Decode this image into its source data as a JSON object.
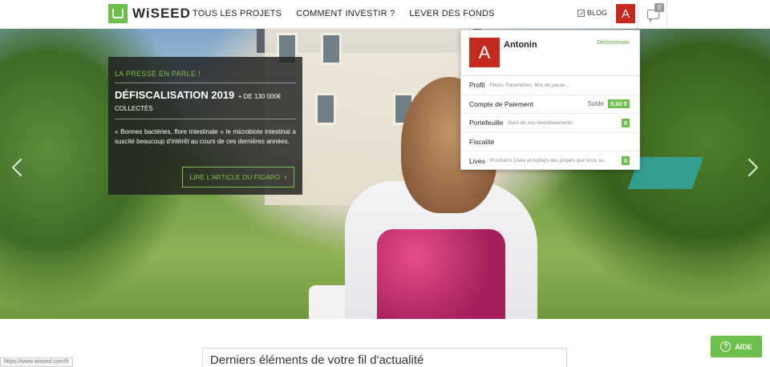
{
  "header": {
    "brand": "WiSEED",
    "nav": [
      "TOUS LES PROJETS",
      "COMMENT INVESTIR ?",
      "LEVER DES FONDS"
    ],
    "blog": "BLOG",
    "avatar_letter": "A",
    "messages_count": "0"
  },
  "press": {
    "label": "LA PRESSE EN PARLE !",
    "title_big": "DÉFISCALISATION 2019",
    "title_small": "+ DE 130 000€",
    "title_line2": "COLLECTÉS",
    "text": "« Bonnes bactéries, flore intestinale » le microbiote intestinal a suscité beaucoup d'intérêt au cours de ces dernières années.",
    "button": "LIRE L'ARTICLE DU FIGARO"
  },
  "dropdown": {
    "avatar_letter": "A",
    "name": "Antonin",
    "logout": "Déconnexion",
    "rows": [
      {
        "title": "Profil",
        "sub": "Photo, Paramètres, Mot de passe..."
      },
      {
        "title": "Compte de Paiement",
        "solde_label": "Solde",
        "badge": "0,00 €"
      },
      {
        "title": "Portefeuille",
        "sub": "Suivi de vos investissements",
        "badge": "0"
      },
      {
        "title": "Fiscalité"
      },
      {
        "title": "Lives",
        "sub": "Prochains Lives et replays des projets que vous su...",
        "badge": "0"
      }
    ]
  },
  "feed_title": "Derniers éléments de votre fil d'actualité",
  "help_button": "AIDE",
  "status_url": "https://www.wiseed.com/fr",
  "colors": {
    "brand_green": "#6cc04a",
    "avatar_red": "#c52a1e"
  }
}
